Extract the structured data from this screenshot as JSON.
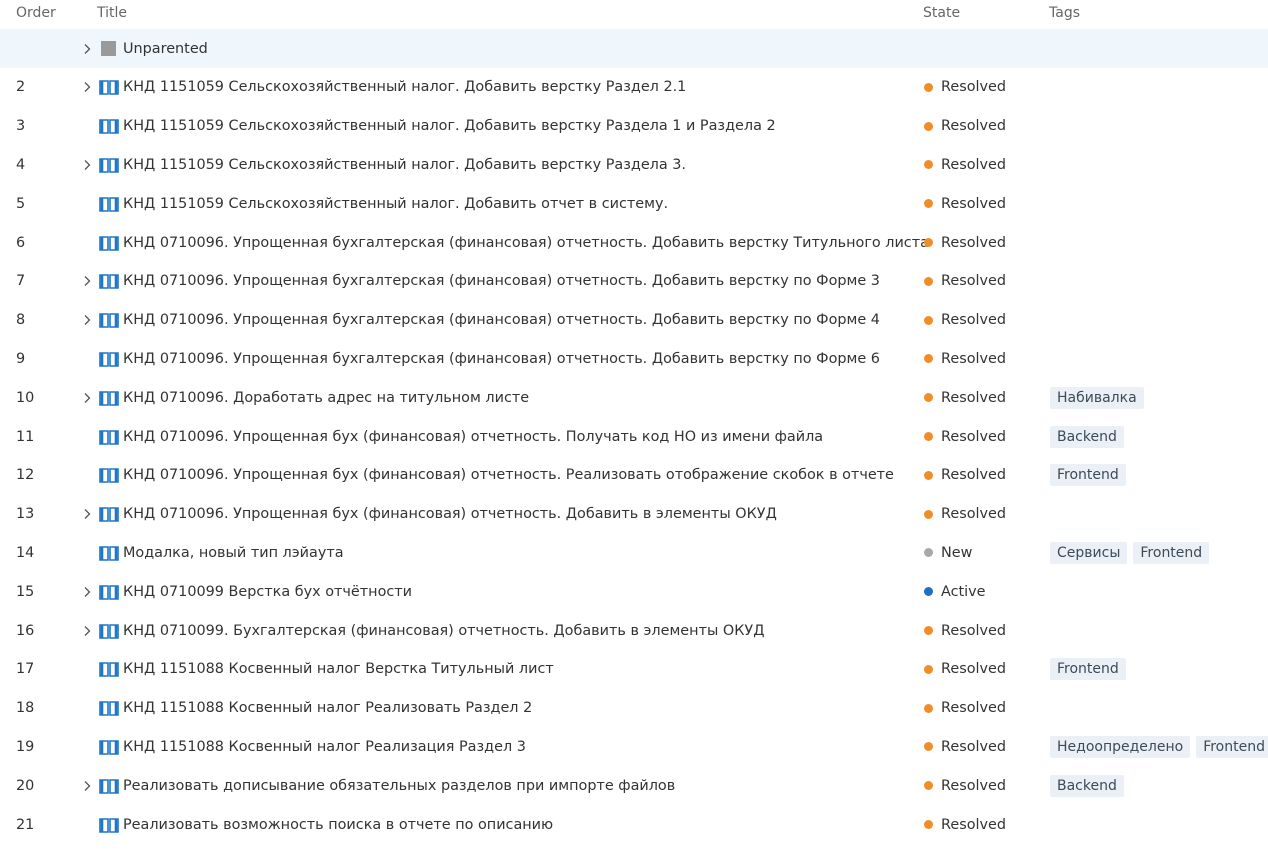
{
  "columns": {
    "order": "Order",
    "title": "Title",
    "state": "State",
    "tags": "Tags"
  },
  "colors": {
    "resolved": "#f08d27",
    "new": "#a8a8a8",
    "active": "#1e6fc3",
    "book_icon": "#1e76c8"
  },
  "unparented": {
    "label": "Unparented",
    "icon": "gray-square-icon"
  },
  "rows": [
    {
      "order": "2",
      "expandable": true,
      "title": "КНД 1151059 Сельскохозяйственный налог. Добавить верстку Раздел 2.1",
      "state": "Resolved",
      "tags": []
    },
    {
      "order": "3",
      "expandable": false,
      "title": "КНД 1151059 Сельскохозяйственный налог. Добавить верстку Раздела 1 и Раздела 2",
      "state": "Resolved",
      "tags": []
    },
    {
      "order": "4",
      "expandable": true,
      "title": "КНД 1151059 Сельскохозяйственный налог. Добавить верстку Раздела 3.",
      "state": "Resolved",
      "tags": []
    },
    {
      "order": "5",
      "expandable": false,
      "title": "КНД 1151059 Сельскохозяйственный налог. Добавить отчет в систему.",
      "state": "Resolved",
      "tags": []
    },
    {
      "order": "6",
      "expandable": false,
      "title": "КНД 0710096. Упрощенная бухгалтерская (финансовая) отчетность. Добавить верстку Титульного листа",
      "state": "Resolved",
      "tags": []
    },
    {
      "order": "7",
      "expandable": true,
      "title": "КНД 0710096. Упрощенная бухгалтерская (финансовая) отчетность. Добавить верстку по Форме 3",
      "state": "Resolved",
      "tags": []
    },
    {
      "order": "8",
      "expandable": true,
      "title": "КНД 0710096. Упрощенная бухгалтерская (финансовая) отчетность. Добавить верстку по Форме 4",
      "state": "Resolved",
      "tags": []
    },
    {
      "order": "9",
      "expandable": false,
      "title": "КНД 0710096. Упрощенная бухгалтерская (финансовая) отчетность. Добавить верстку по Форме 6",
      "state": "Resolved",
      "tags": []
    },
    {
      "order": "10",
      "expandable": true,
      "title": "КНД 0710096. Доработать адрес на титульном листе",
      "state": "Resolved",
      "tags": [
        "Набивалка"
      ]
    },
    {
      "order": "11",
      "expandable": false,
      "title": "КНД 0710096. Упрощенная бух (финансовая) отчетность. Получать код НО из имени файла",
      "state": "Resolved",
      "tags": [
        "Backend"
      ]
    },
    {
      "order": "12",
      "expandable": false,
      "title": "КНД 0710096. Упрощенная бух (финансовая) отчетность. Реализовать отображение скобок в отчете",
      "state": "Resolved",
      "tags": [
        "Frontend"
      ]
    },
    {
      "order": "13",
      "expandable": true,
      "title": "КНД 0710096. Упрощенная бух (финансовая) отчетность. Добавить в элементы ОКУД",
      "state": "Resolved",
      "tags": []
    },
    {
      "order": "14",
      "expandable": false,
      "title": "Модалка, новый тип лэйаута",
      "state": "New",
      "tags": [
        "Сервисы",
        "Frontend"
      ]
    },
    {
      "order": "15",
      "expandable": true,
      "title": "КНД 0710099 Верстка бух отчётности",
      "state": "Active",
      "tags": []
    },
    {
      "order": "16",
      "expandable": true,
      "title": "КНД 0710099. Бухгалтерская (финансовая) отчетность. Добавить в элементы ОКУД",
      "state": "Resolved",
      "tags": []
    },
    {
      "order": "17",
      "expandable": false,
      "title": "КНД 1151088 Косвенный налог Верстка Титульный лист",
      "state": "Resolved",
      "tags": [
        "Frontend"
      ]
    },
    {
      "order": "18",
      "expandable": false,
      "title": "КНД 1151088 Косвенный налог Реализовать Раздел 2",
      "state": "Resolved",
      "tags": []
    },
    {
      "order": "19",
      "expandable": false,
      "title": "КНД 1151088 Косвенный налог Реализация Раздел 3",
      "state": "Resolved",
      "tags": [
        "Недоопределено",
        "Frontend"
      ]
    },
    {
      "order": "20",
      "expandable": true,
      "title": "Реализовать дописывание обязательных разделов при импорте файлов",
      "state": "Resolved",
      "tags": [
        "Backend"
      ]
    },
    {
      "order": "21",
      "expandable": false,
      "title": "Реализовать возможность поиска в отчете по описанию",
      "state": "Resolved",
      "tags": []
    }
  ]
}
